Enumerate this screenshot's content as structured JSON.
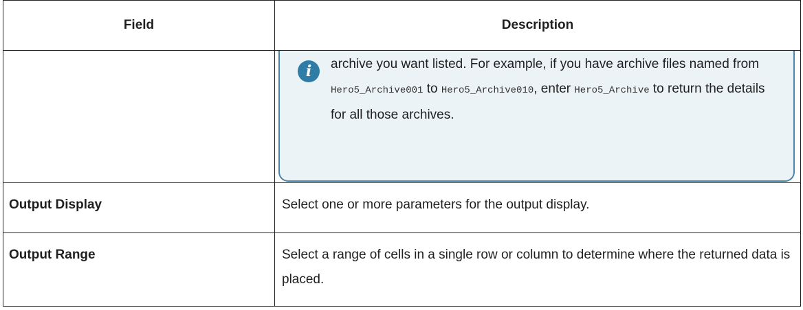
{
  "table": {
    "headers": {
      "field": "Field",
      "description": "Description"
    },
    "note": {
      "text_1": "archive you want listed. For example, if you have archive files named from ",
      "code_1": "Hero5_Archive001",
      "text_2": " to ",
      "code_2": "Hero5_Archive010",
      "text_3": ", enter ",
      "code_3": "Hero5_Archive",
      "text_4": " to return the details for all those archives."
    },
    "rows": [
      {
        "field": "Output Display",
        "description": "Select one or more parameters for the output display."
      },
      {
        "field": "Output Range",
        "description": "Select a range of cells in a single row or column to determine where the returned data is placed."
      }
    ]
  }
}
